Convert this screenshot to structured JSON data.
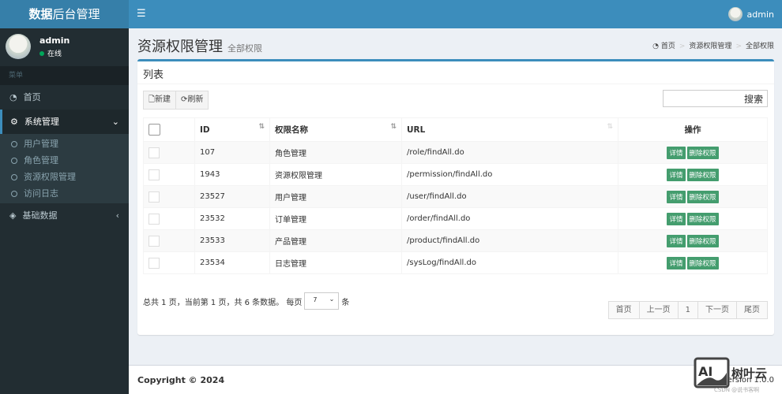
{
  "header": {
    "logo_bold": "数据",
    "logo_rest": "后台管理",
    "toggle_icon": "bars-icon",
    "user": "admin"
  },
  "sidebar": {
    "user": "admin",
    "status": "在线",
    "section": "菜单",
    "items": [
      {
        "label": "首页",
        "icon": "dashboard-icon"
      },
      {
        "label": "系统管理",
        "icon": "cogs-icon",
        "expanded": true
      },
      {
        "label": "基础数据",
        "icon": "cube-icon"
      }
    ],
    "sub_items": [
      "用户管理",
      "角色管理",
      "资源权限管理",
      "访问日志"
    ]
  },
  "page": {
    "title": "资源权限管理",
    "subtitle": "全部权限",
    "breadcrumb": [
      "首页",
      "资源权限管理",
      "全部权限"
    ]
  },
  "box": {
    "title": "列表",
    "new_label": "新建",
    "refresh_label": "刷新",
    "search_placeholder": "搜索"
  },
  "table": {
    "headers": [
      "ID",
      "权限名称",
      "URL",
      "操作"
    ],
    "rows": [
      {
        "id": "107",
        "name": "角色管理",
        "url": "/role/findAll.do"
      },
      {
        "id": "1943",
        "name": "资源权限管理",
        "url": "/permission/findAll.do"
      },
      {
        "id": "23527",
        "name": "用户管理",
        "url": "/user/findAll.do"
      },
      {
        "id": "23532",
        "name": "订单管理",
        "url": "/order/findAll.do"
      },
      {
        "id": "23533",
        "name": "产品管理",
        "url": "/product/findAll.do"
      },
      {
        "id": "23534",
        "name": "日志管理",
        "url": "/sysLog/findAll.do"
      }
    ],
    "detail_label": "详情",
    "delete_label": "删除权限"
  },
  "pagination": {
    "info": "总共 1 页，当前第 1 页，共 6 条数据。 每页",
    "page_size": "7",
    "unit": "条",
    "buttons": [
      "首页",
      "上一页",
      "1",
      "下一页",
      "尾页"
    ]
  },
  "footer": {
    "copyright": "Copyright © 2024",
    "version": "Version 1.0.0"
  },
  "watermark": {
    "text": "AI 树叶云",
    "sub": "CSDN @说书客啊"
  },
  "colors": {
    "header": "#3c8dbc",
    "sidebar": "#222d32",
    "button_success": "#449d6e"
  }
}
